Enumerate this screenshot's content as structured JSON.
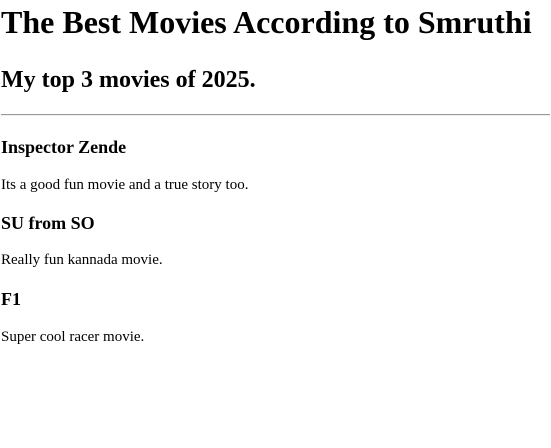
{
  "page": {
    "title": "The Best Movies According to Smruthi",
    "subtitle": "My top 3 movies of 2025."
  },
  "movies": [
    {
      "title": "Inspector Zende",
      "description": "Its a good fun movie and a true story too."
    },
    {
      "title": "SU from SO",
      "description": "Really fun kannada movie."
    },
    {
      "title": "F1",
      "description": "Super cool racer movie."
    }
  ]
}
